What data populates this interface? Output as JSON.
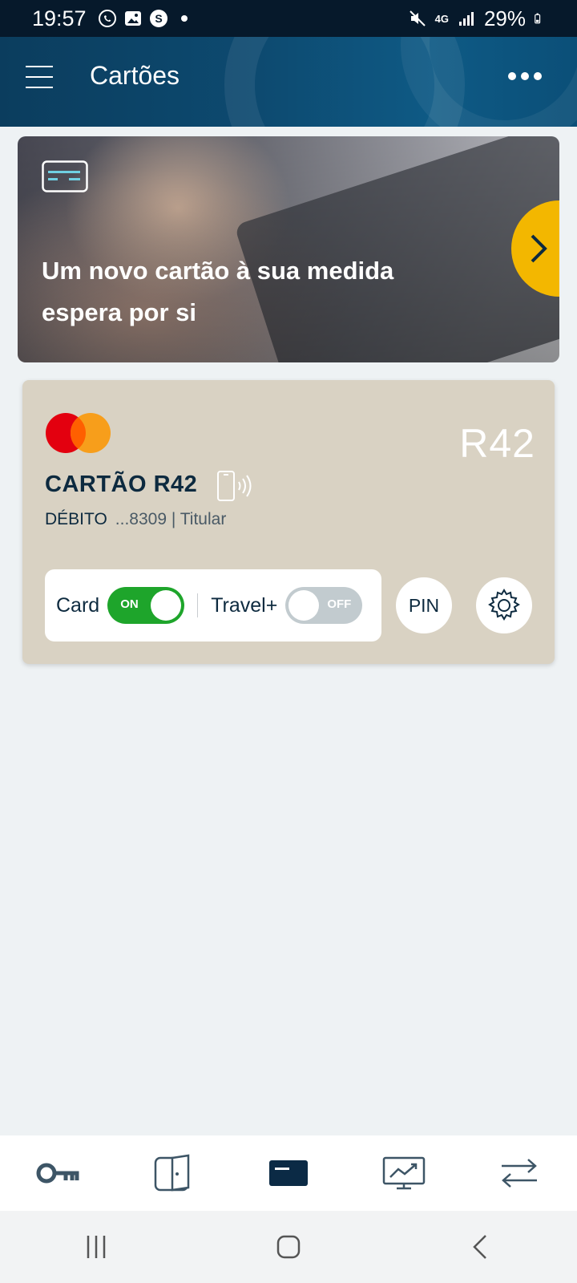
{
  "status_bar": {
    "time": "19:57",
    "battery": "29%",
    "network": "4G",
    "icons": [
      "whatsapp-icon",
      "gallery-icon",
      "s-app-icon",
      "dot-icon",
      "mute-icon",
      "signal-icon",
      "battery-icon"
    ]
  },
  "header": {
    "title": "Cartões",
    "menu_icon": "hamburger-icon",
    "more_icon": "more-icon"
  },
  "banner": {
    "text": "Um novo cartão à sua medida espera por si",
    "icon": "card-outline-icon",
    "next_icon": "chevron-right-icon",
    "accent": "#f3b700"
  },
  "card": {
    "brand_logo": "R42",
    "name": "CARTÃO R42",
    "type": "DÉBITO",
    "number": "...8309 | Titular",
    "network_logo": "mastercard-logo",
    "background": "#d9d2c3",
    "controls": {
      "card_label": "Card",
      "card_state": "ON",
      "travel_label": "Travel+",
      "travel_state": "OFF",
      "pin_label": "PIN"
    },
    "on_color": "#1ea52b"
  },
  "bottom_nav": {
    "items": [
      {
        "icon": "key-icon",
        "active": false
      },
      {
        "icon": "wallet-icon",
        "active": false
      },
      {
        "icon": "card-icon",
        "active": true
      },
      {
        "icon": "chart-monitor-icon",
        "active": false
      },
      {
        "icon": "transfer-icon",
        "active": false
      }
    ]
  },
  "system_nav": {
    "items": [
      "recents-icon",
      "home-icon",
      "back-icon"
    ]
  }
}
